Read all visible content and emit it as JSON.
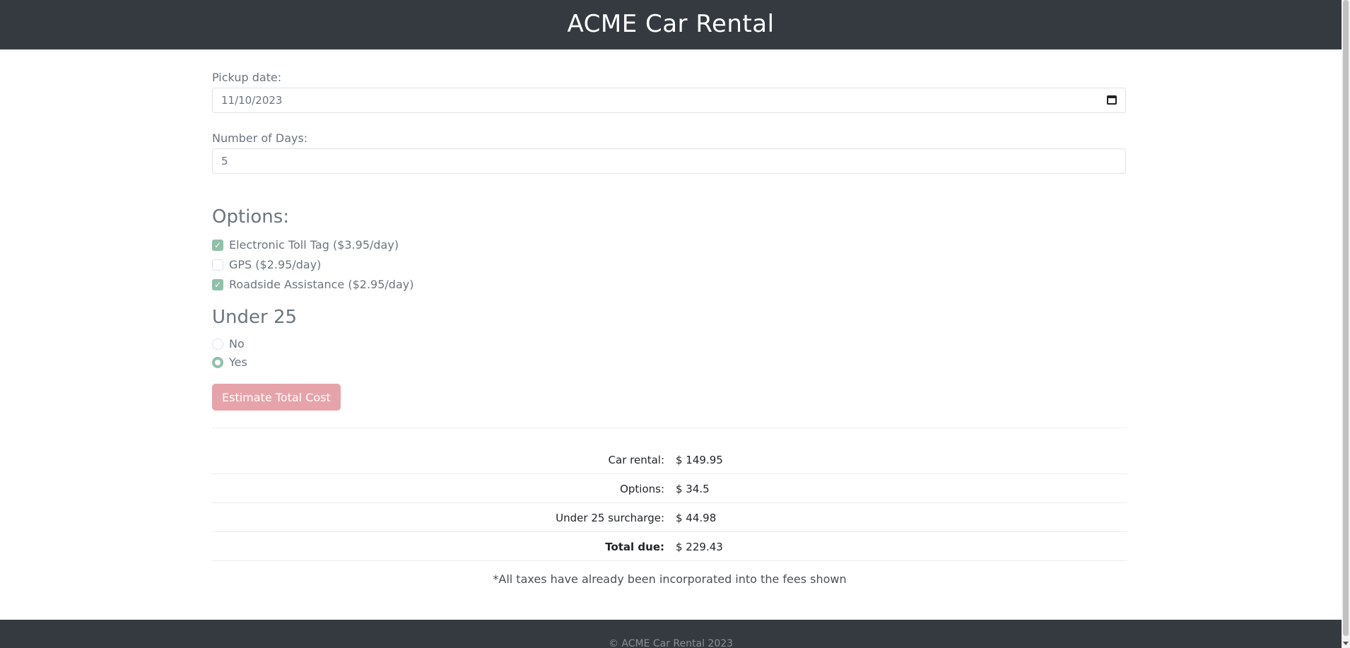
{
  "header": {
    "title": "ACME Car Rental"
  },
  "form": {
    "pickup_label": "Pickup date:",
    "pickup_value": "11/10/2023",
    "days_label": "Number of Days:",
    "days_value": "5",
    "options_heading": "Options:",
    "options": [
      {
        "label": "Electronic Toll Tag ($3.95/day)",
        "checked": true
      },
      {
        "label": "GPS ($2.95/day)",
        "checked": false
      },
      {
        "label": "Roadside Assistance ($2.95/day)",
        "checked": true
      }
    ],
    "under25_heading": "Under 25",
    "under25_choices": [
      {
        "label": "No",
        "selected": false
      },
      {
        "label": "Yes",
        "selected": true
      }
    ],
    "estimate_button": "Estimate Total Cost"
  },
  "costs": {
    "rows": [
      {
        "label": "Car rental:",
        "value": "$ 149.95"
      },
      {
        "label": "Options:",
        "value": "$ 34.5"
      },
      {
        "label": "Under 25 surcharge:",
        "value": "$ 44.98"
      },
      {
        "label": "Total due:",
        "value": "$ 229.43"
      }
    ],
    "note": "*All taxes have already been incorporated into the fees shown"
  },
  "footer": {
    "text": "© ACME Car Rental 2023"
  },
  "colors": {
    "header_bg": "#343a40",
    "accent_green": "#8fc0a9",
    "button_pink": "#e6a3aa"
  }
}
